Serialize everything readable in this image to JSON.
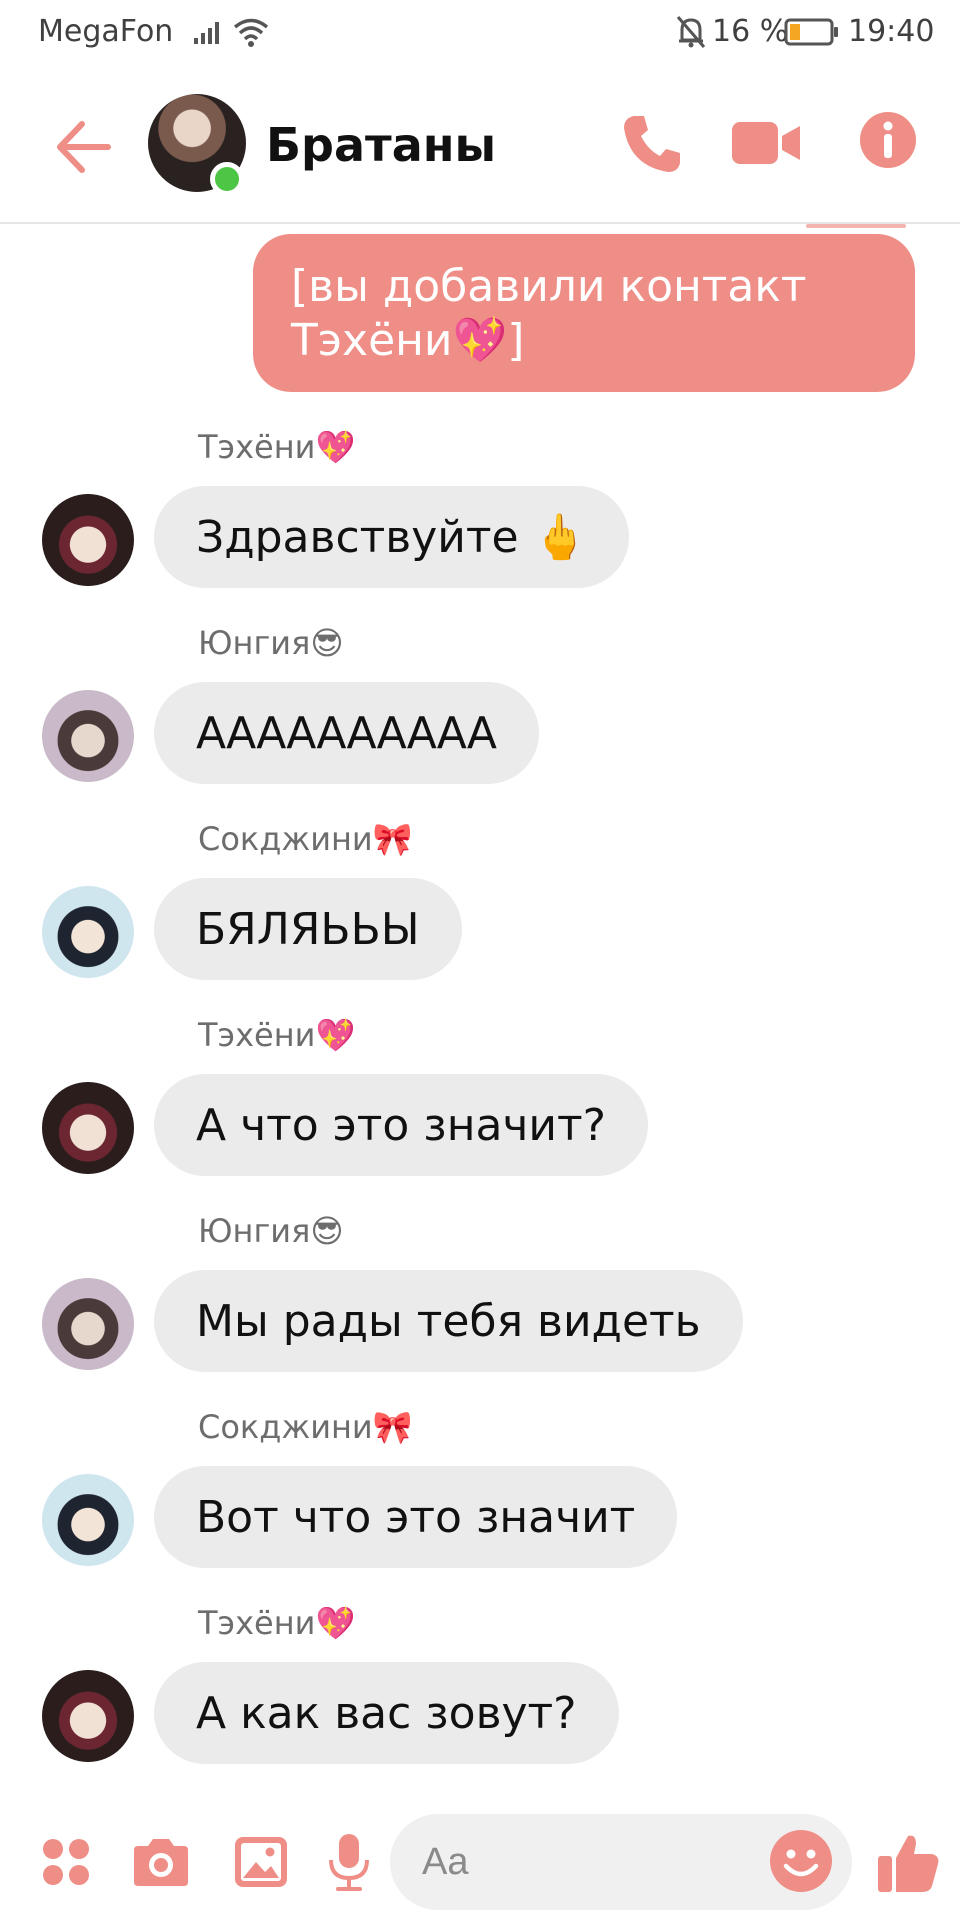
{
  "status_bar": {
    "carrier": "MegaFon",
    "battery": "16 %",
    "time": "19:40",
    "icons": [
      "signal-icon",
      "wifi-icon",
      "bell-off-icon",
      "battery-icon"
    ]
  },
  "header": {
    "title": "Братаны",
    "online": true,
    "icons": [
      "back-arrow-icon",
      "phone-icon",
      "video-camera-icon",
      "info-icon"
    ]
  },
  "colors": {
    "accent": "#ef8e86",
    "incoming_bubble": "#ebebeb",
    "online": "#4cc644"
  },
  "messages": [
    {
      "type": "outgoing",
      "text": "[вы добавили контакт Тэхёни💖]"
    },
    {
      "type": "incoming",
      "sender": "Тэхёни💖",
      "text": "Здравствуйте 🖕"
    },
    {
      "type": "incoming",
      "sender": "Юнгия😎",
      "text": "АААААААААА"
    },
    {
      "type": "incoming",
      "sender": "Сокджини🎀",
      "text": "БЯЛЯЬЬЫ"
    },
    {
      "type": "incoming",
      "sender": "Тэхёни💖",
      "text": "А что это значит?"
    },
    {
      "type": "incoming",
      "sender": "Юнгия😎",
      "text": "Мы рады тебя видеть"
    },
    {
      "type": "incoming",
      "sender": "Сокджини🎀",
      "text": "Вот что это значит"
    },
    {
      "type": "incoming",
      "sender": "Тэхёни💖",
      "text": "А как вас зовут?"
    }
  ],
  "composer": {
    "placeholder": "Aa",
    "icons": [
      "menu-dots-icon",
      "camera-icon",
      "gallery-icon",
      "microphone-icon",
      "emoji-icon",
      "thumbs-up-icon"
    ]
  }
}
